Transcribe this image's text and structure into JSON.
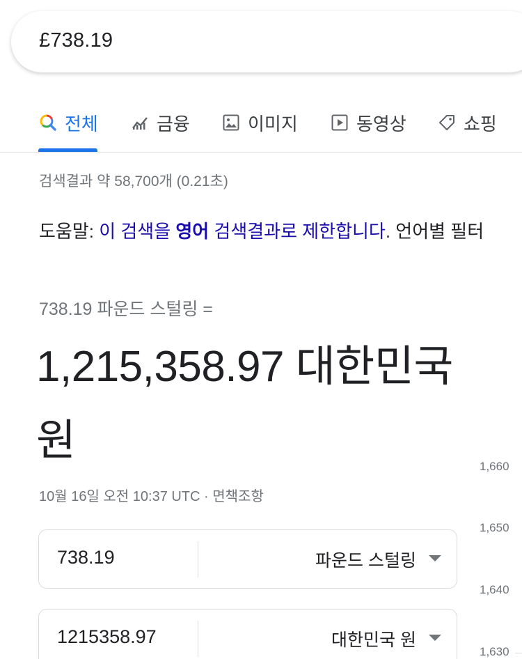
{
  "search": {
    "query": "£738.19"
  },
  "tabs": [
    {
      "label": "전체",
      "icon": "google-search-icon",
      "active": true
    },
    {
      "label": "금융",
      "icon": "finance-chart-icon"
    },
    {
      "label": "이미지",
      "icon": "image-icon"
    },
    {
      "label": "동영상",
      "icon": "video-play-icon"
    },
    {
      "label": "쇼핑",
      "icon": "shopping-tag-icon"
    }
  ],
  "result_stats": "검색결과 약 58,700개 (0.21초)",
  "help": {
    "prefix": "도움말: ",
    "link_part1": "이 검색을 ",
    "link_bold": "영어",
    "link_part2": " 검색결과로 제한합니다",
    "suffix": ". 언어별 필터"
  },
  "converter": {
    "from_line": "738.19 파운드 스털링 =",
    "result": "1,215,358.97 대한민국 원",
    "timestamp": "10월 16일 오전 10:37 UTC · 면책조항",
    "from_amount": "738.19",
    "from_currency": "파운드 스털링",
    "to_amount": "1215358.97",
    "to_currency": "대한민국 원"
  },
  "chart_axis": {
    "ticks": [
      "1,660",
      "1,650",
      "1,640",
      "1,630"
    ]
  },
  "colors": {
    "accent": "#1a73e8",
    "link": "#1a0dab",
    "muted": "#70757a"
  }
}
